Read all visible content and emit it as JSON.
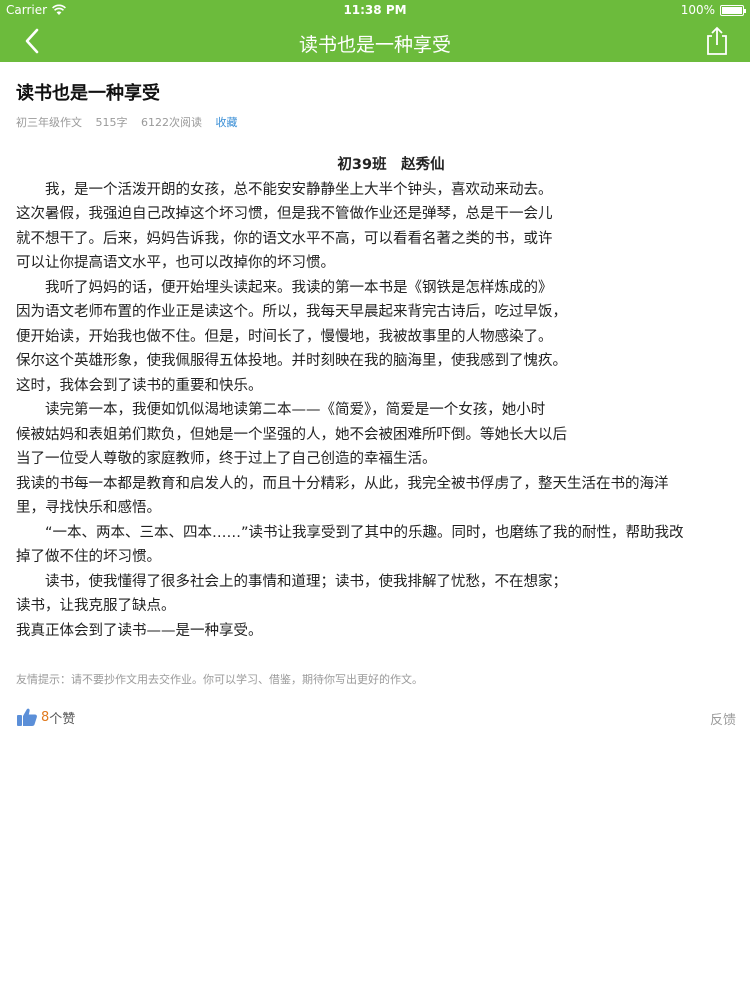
{
  "status_bar": {
    "carrier": "Carrier",
    "time": "11:38 PM",
    "battery": "100%",
    "battery_level": 1.0
  },
  "nav": {
    "title": "读书也是一种享受",
    "back_icon": "chevron-left-icon",
    "share_icon": "share-icon"
  },
  "article": {
    "title": "读书也是一种享受",
    "meta": {
      "grade": "初三年级作文",
      "words": "515字",
      "reads": "6122次阅读",
      "favorite": "收藏"
    },
    "author_line": "初39班　赵秀仙",
    "lines": [
      "　　我，是一个活泼开朗的女孩，总不能安安静静坐上大半个钟头，喜欢动来动去。",
      "这次暑假，我强迫自己改掉这个坏习惯，但是我不管做作业还是弹琴，总是干一会儿",
      "就不想干了。后来，妈妈告诉我，你的语文水平不高，可以看看名著之类的书，或许",
      "可以让你提高语文水平，也可以改掉你的坏习惯。",
      "　　我听了妈妈的话，便开始埋头读起来。我读的第一本书是《钢铁是怎样炼成的》",
      "因为语文老师布置的作业正是读这个。所以，我每天早晨起来背完古诗后，吃过早饭，",
      "便开始读，开始我也做不住。但是，时间长了，慢慢地，我被故事里的人物感染了。",
      "保尔这个英雄形象，使我佩服得五体投地。并时刻映在我的脑海里，使我感到了愧疚。",
      "这时，我体会到了读书的重要和快乐。",
      "　　读完第一本，我便如饥似渴地读第二本——《简爱》，简爱是一个女孩，她小时",
      "候被姑妈和表姐弟们欺负，但她是一个坚强的人，她不会被困难所吓倒。等她长大以后",
      "当了一位受人尊敬的家庭教师，终于过上了自己创造的幸福生活。",
      "我读的书每一本都是教育和启发人的，而且十分精彩，从此，我完全被书俘虏了，整天生活在书的海洋",
      "里，寻找快乐和感悟。",
      "　　“一本、两本、三本、四本……”读书让我享受到了其中的乐趣。同时，也磨练了我的耐性，帮助我改",
      "掉了做不住的坏习惯。",
      "　　读书，使我懂得了很多社会上的事情和道理；读书，使我排解了忧愁，不在想家；",
      "读书，让我克服了缺点。",
      "我真正体会到了读书——是一种享受。"
    ],
    "tip": "友情提示：请不要抄作文用去交作业。你可以学习、借鉴，期待你写出更好的作文。",
    "likes": {
      "count": "8",
      "unit": "个赞",
      "icon": "thumbs-up-icon"
    },
    "feedback": "反馈"
  },
  "colors": {
    "nav_green": "#6cbb3c",
    "like_count": "#e07a1f",
    "link_blue": "#3b8fd6"
  }
}
